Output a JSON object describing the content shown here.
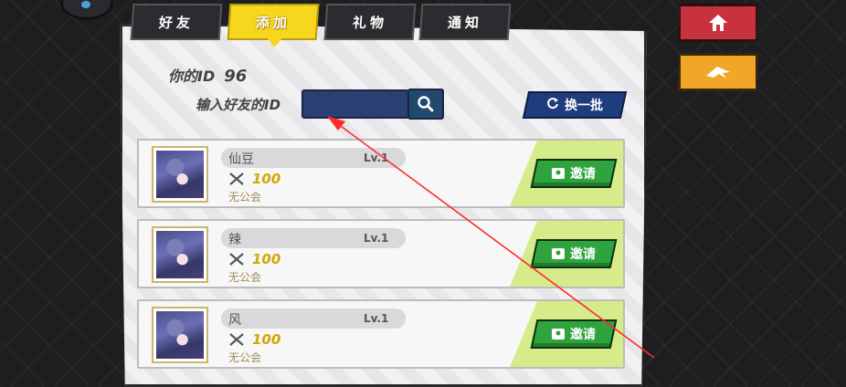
{
  "tabs": [
    "好友",
    "添加",
    "礼物",
    "通知"
  ],
  "active_tab": 1,
  "my_id": {
    "label": "你的ID",
    "value": "96"
  },
  "search": {
    "label": "输入好友的ID",
    "value": "",
    "placeholder": ""
  },
  "refresh_label": "换一批",
  "players": [
    {
      "name": "仙豆",
      "level": "Lv.1",
      "power": "100",
      "guild": "无公会",
      "invite_label": "邀请"
    },
    {
      "name": "辣",
      "level": "Lv.1",
      "power": "100",
      "guild": "无公会",
      "invite_label": "邀请"
    },
    {
      "name": "风",
      "level": "Lv.1",
      "power": "100",
      "guild": "无公会",
      "invite_label": "邀请"
    }
  ],
  "colors": {
    "accent_yellow": "#f6d61f",
    "invite_green": "#2fa43e",
    "home_red": "#c8323e",
    "back_orange": "#f0a626",
    "annotation_red": "#ff2a2a"
  },
  "icons": {
    "search": "search-icon",
    "refresh": "refresh-icon",
    "invite": "add-friend-icon",
    "home": "home-icon",
    "back": "back-icon",
    "power": "crossed-swords-icon"
  }
}
